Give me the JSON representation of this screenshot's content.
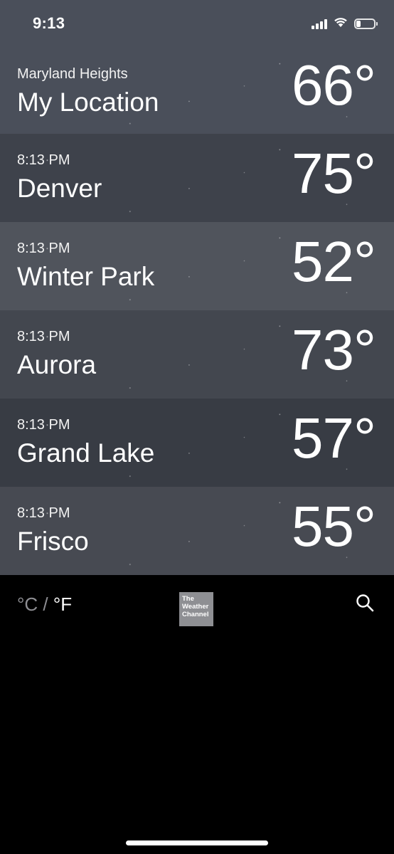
{
  "status_bar": {
    "time": "9:13",
    "icons": [
      "cellular-signal-icon",
      "wifi-icon",
      "battery-icon"
    ],
    "battery_level": 0.25
  },
  "cities": [
    {
      "subtitle": "Maryland Heights",
      "name": "My Location",
      "temp": "66°",
      "bg": "#4a4f5a"
    },
    {
      "subtitle": "8:13 PM",
      "name": "Denver",
      "temp": "75°",
      "bg": "#3e424b"
    },
    {
      "subtitle": "8:13 PM",
      "name": "Winter Park",
      "temp": "52°",
      "bg": "#50545c"
    },
    {
      "subtitle": "8:13 PM",
      "name": "Aurora",
      "temp": "73°",
      "bg": "#43474f"
    },
    {
      "subtitle": "8:13 PM",
      "name": "Grand Lake",
      "temp": "57°",
      "bg": "#383c44"
    },
    {
      "subtitle": "8:13 PM",
      "name": "Frisco",
      "temp": "55°",
      "bg": "#474a52"
    }
  ],
  "footer": {
    "unit_celsius": "°C",
    "unit_separator": " / ",
    "unit_fahrenheit": "°F",
    "selected_unit": "°F",
    "logo_lines": [
      "The",
      "Weather",
      "Channel"
    ],
    "search_icon": "search-icon"
  },
  "colors": {
    "status_bar_bg": "#4a4f5a",
    "footer_bg": "#000000",
    "unit_inactive": "#8e8e93",
    "logo_bg": "#8e8f93"
  }
}
